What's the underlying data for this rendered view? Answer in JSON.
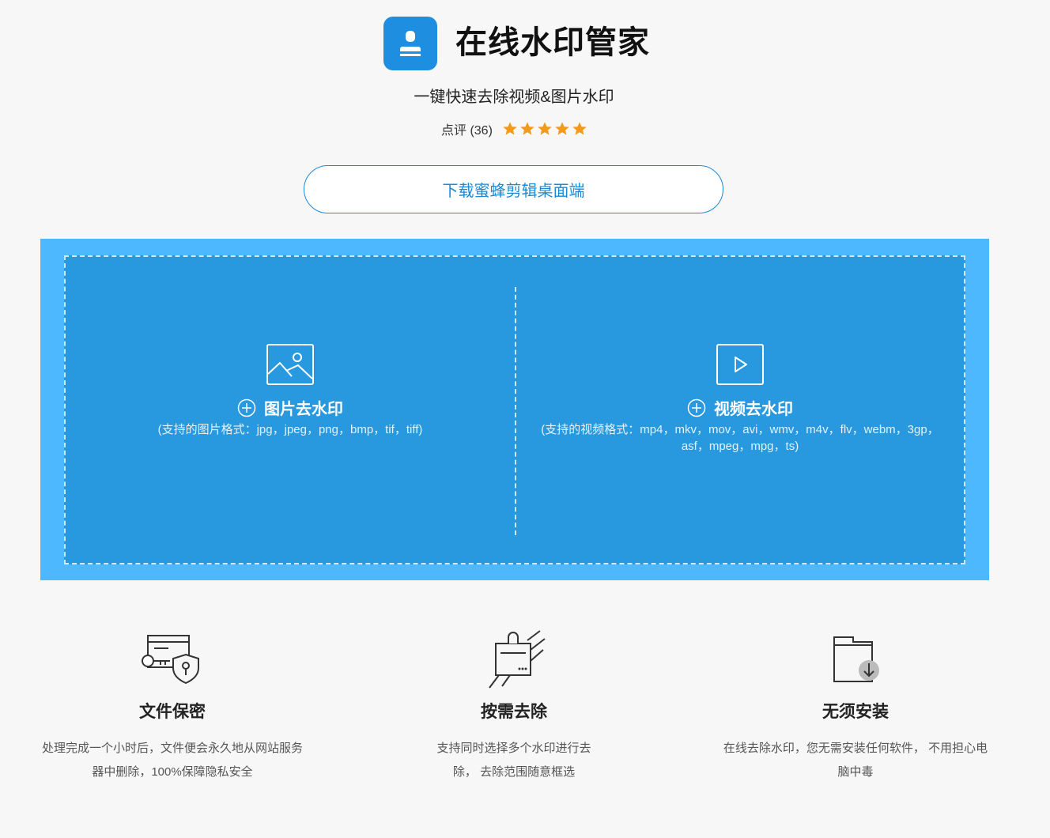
{
  "header": {
    "title": "在线水印管家",
    "tagline": "一键快速去除视频&图片水印",
    "rating_label": "点评 (36)",
    "stars": 5,
    "accent_color": "#1e8fe0",
    "star_color": "#f39a1c"
  },
  "download_button": {
    "label": "下载蜜蜂剪辑桌面端"
  },
  "upload": {
    "image": {
      "title": "图片去水印",
      "formats": "(支持的图片格式：jpg，jpeg，png，bmp，tif，tiff)",
      "icon": "image-icon"
    },
    "video": {
      "title": "视频去水印",
      "formats": "(支持的视频格式：mp4，mkv，mov，avi，wmv，m4v，flv，webm，3gp，asf，mpeg，mpg，ts)",
      "icon": "play-icon"
    }
  },
  "features": [
    {
      "title": "文件保密",
      "desc": "处理完成一个小时后，文件便会永久地从网站服务器中删除，100%保障隐私安全",
      "icon": "secure-file-icon"
    },
    {
      "title": "按需去除",
      "desc": "支持同时选择多个水印进行去除， 去除范围随意框选",
      "icon": "stamp-icon"
    },
    {
      "title": "无须安装",
      "desc": "在线去除水印，您无需安装任何软件， 不用担心电脑中毒",
      "icon": "folder-download-icon"
    }
  ]
}
